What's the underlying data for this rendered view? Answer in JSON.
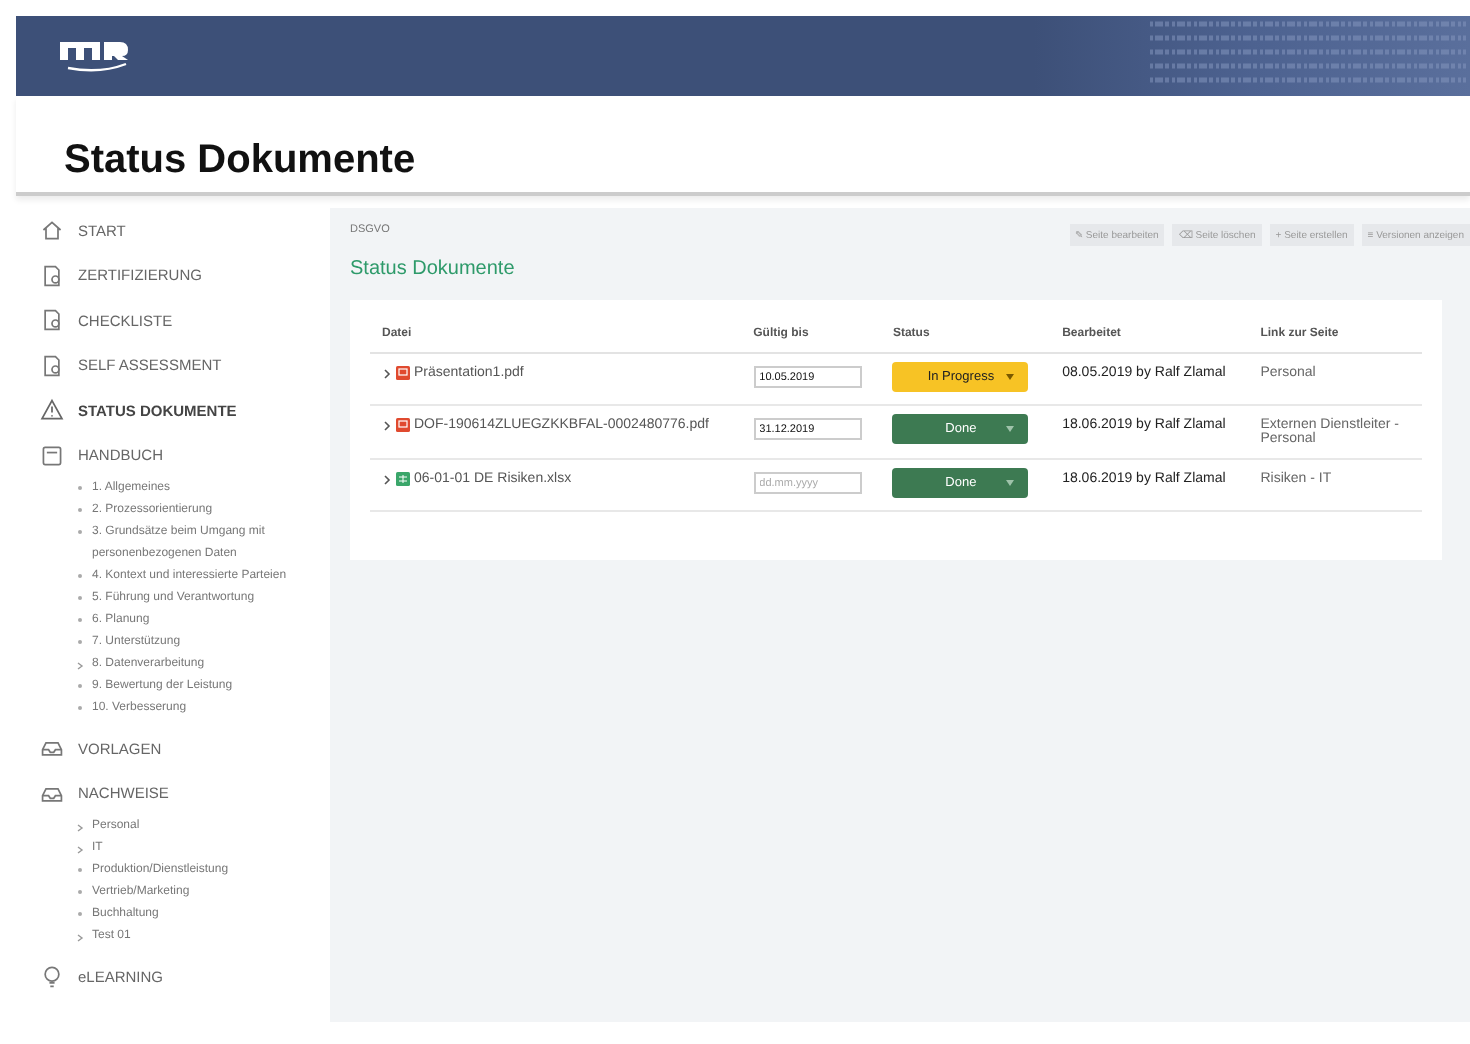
{
  "page_title": "Status Dokumente",
  "sidebar": {
    "items": [
      {
        "label": "START",
        "selected": false
      },
      {
        "label": "ZERTIFIZIERUNG",
        "selected": false
      },
      {
        "label": "CHECKLISTE",
        "selected": false
      },
      {
        "label": "SELF ASSESSMENT",
        "selected": false
      },
      {
        "label": "STATUS DOKUMENTE",
        "selected": true
      },
      {
        "label": "HANDBUCH",
        "selected": false,
        "children": [
          {
            "label": "1. Allgemeines",
            "expandable": false
          },
          {
            "label": "2. Prozessorientierung",
            "expandable": false
          },
          {
            "label": "3. Grundsätze beim Umgang mit personenbezogenen Daten",
            "expandable": false
          },
          {
            "label": "4. Kontext und interessierte Parteien",
            "expandable": false
          },
          {
            "label": "5. Führung und Verantwortung",
            "expandable": false
          },
          {
            "label": "6. Planung",
            "expandable": false
          },
          {
            "label": "7. Unterstützung",
            "expandable": false
          },
          {
            "label": "8. Datenverarbeitung",
            "expandable": true
          },
          {
            "label": "9. Bewertung der Leistung",
            "expandable": false
          },
          {
            "label": "10. Verbesserung",
            "expandable": false
          }
        ]
      },
      {
        "label": "VORLAGEN",
        "selected": false
      },
      {
        "label": "NACHWEISE",
        "selected": false,
        "children": [
          {
            "label": "Personal",
            "expandable": true
          },
          {
            "label": "IT",
            "expandable": true
          },
          {
            "label": "Produktion/Dienstleistung",
            "expandable": false
          },
          {
            "label": "Vertrieb/Marketing",
            "expandable": false
          },
          {
            "label": "Buchhaltung",
            "expandable": false
          },
          {
            "label": "Test 01",
            "expandable": true
          }
        ]
      },
      {
        "label": "eLEARNING",
        "selected": false
      }
    ]
  },
  "content": {
    "breadcrumb": "DSGVO",
    "title": "Status Dokumente",
    "actions": [
      "✎ Seite bearbeiten",
      "⌫ Seite löschen",
      "+ Seite erstellen",
      "≡ Versionen anzeigen"
    ],
    "table": {
      "columns": [
        "Datei",
        "Gültig bis",
        "Status",
        "Bearbeitet",
        "Link zur Seite"
      ],
      "rows": [
        {
          "kind": "pdf",
          "file": "Präsentation1.pdf",
          "valid_until": "10.05.2019",
          "status": {
            "label": "In Progress",
            "kind": "in_progress"
          },
          "edited": "08.05.2019 by Ralf Zlamal",
          "link": "Personal"
        },
        {
          "kind": "pdf",
          "file": "DOF-190614ZLUEGZKKBFAL-0002480776.pdf",
          "valid_until": "31.12.2019",
          "status": {
            "label": "Done",
            "kind": "done"
          },
          "edited": "18.06.2019 by Ralf Zlamal",
          "link": "Externen Dienstleiter - Personal"
        },
        {
          "kind": "xlsx",
          "file": "06-01-01 DE Risiken.xlsx",
          "valid_until_placeholder": "dd.mm.yyyy",
          "status": {
            "label": "Done",
            "kind": "done"
          },
          "edited": "18.06.2019 by Ralf Zlamal",
          "link": "Risiken - IT"
        }
      ]
    }
  }
}
